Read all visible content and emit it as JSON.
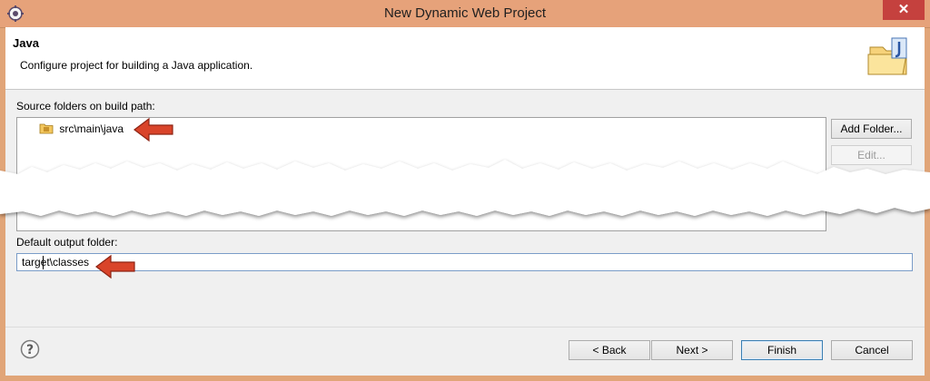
{
  "window": {
    "title": "New Dynamic Web Project",
    "close_label": "✕"
  },
  "banner": {
    "title": "Java",
    "description": "Configure project for building a Java application."
  },
  "source_folders": {
    "label": "Source folders on build path:",
    "items": [
      {
        "label": "src\\main\\java"
      }
    ],
    "add_folder_label": "Add Folder...",
    "edit_label": "Edit..."
  },
  "output": {
    "label": "Default output folder:",
    "value": "target\\classes"
  },
  "footer": {
    "back_label": "< Back",
    "next_label": "Next >",
    "finish_label": "Finish",
    "cancel_label": "Cancel"
  },
  "colors": {
    "titlebar": "#e6a27a",
    "close_button": "#c5413e",
    "annotation_arrow": "#d9442a"
  },
  "icons": {
    "app": "eclipse-gear-icon",
    "banner": "java-folder-icon",
    "source_folder": "package-folder-icon",
    "help": "help-icon",
    "annotation": "red-arrow-icon"
  }
}
